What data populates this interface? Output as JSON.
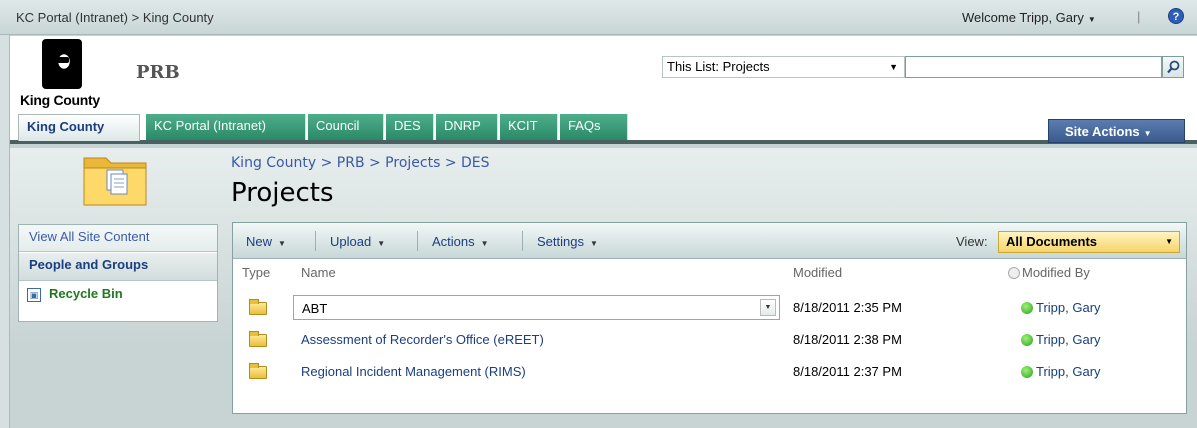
{
  "topbar": {
    "breadcrumb_parent": "KC Portal (Intranet)",
    "breadcrumb_sep": ">",
    "breadcrumb_current": "King County",
    "welcome": "Welcome Tripp, Gary",
    "help_icon": "?"
  },
  "header": {
    "logo_text": "King County",
    "site_title": "PRB",
    "search_scope": "This List: Projects",
    "search_value": ""
  },
  "nav": {
    "tabs": [
      {
        "label": "King County",
        "active": true
      },
      {
        "label": "KC Portal (Intranet)"
      },
      {
        "label": "Council"
      },
      {
        "label": "DES"
      },
      {
        "label": "DNRP"
      },
      {
        "label": "KCIT"
      },
      {
        "label": "FAQs"
      }
    ],
    "site_actions": "Site Actions"
  },
  "page": {
    "breadcrumb": "King County > PRB > Projects > DES",
    "title": "Projects"
  },
  "quicklaunch": {
    "view_all": "View All Site Content",
    "people": "People and Groups",
    "recycle": "Recycle Bin"
  },
  "toolbar": {
    "new": "New",
    "upload": "Upload",
    "actions": "Actions",
    "settings": "Settings",
    "view_label": "View:",
    "view_value": "All Documents"
  },
  "columns": {
    "type": "Type",
    "name": "Name",
    "modified": "Modified",
    "modified_by": "Modified By"
  },
  "rows": [
    {
      "name": "ABT",
      "modified": "8/18/2011 2:35 PM",
      "modified_by": "Tripp, Gary"
    },
    {
      "name": "Assessment of Recorder's Office (eREET)",
      "modified": "8/18/2011 2:38 PM",
      "modified_by": "Tripp, Gary"
    },
    {
      "name": "Regional Incident Management (RIMS)",
      "modified": "8/18/2011 2:37 PM",
      "modified_by": "Tripp, Gary"
    }
  ]
}
